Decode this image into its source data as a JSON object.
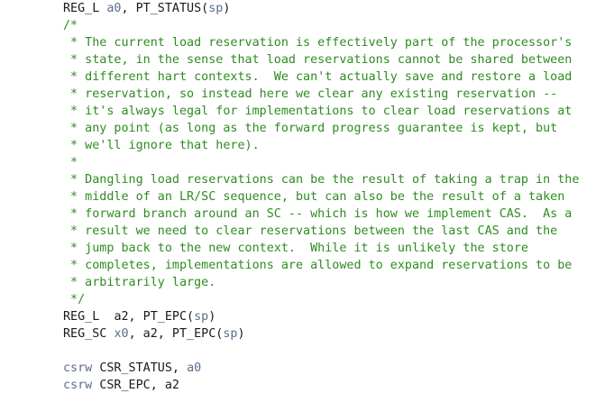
{
  "colors": {
    "comment": "#2e8b20",
    "text": "#1a1a1a",
    "register": "#5a6c8c",
    "background": "#ffffff"
  },
  "lines": [
    {
      "type": "code",
      "parts": [
        {
          "cls": "kw",
          "text": "REG_L "
        },
        {
          "cls": "reg",
          "text": "a0"
        },
        {
          "cls": "kw",
          "text": ", PT_STATUS("
        },
        {
          "cls": "reg",
          "text": "sp"
        },
        {
          "cls": "kw",
          "text": ")"
        }
      ]
    },
    {
      "type": "comment",
      "text": "/*"
    },
    {
      "type": "comment",
      "text": " * The current load reservation is effectively part of the processor's"
    },
    {
      "type": "comment",
      "text": " * state, in the sense that load reservations cannot be shared between"
    },
    {
      "type": "comment",
      "text": " * different hart contexts.  We can't actually save and restore a load"
    },
    {
      "type": "comment",
      "text": " * reservation, so instead here we clear any existing reservation --"
    },
    {
      "type": "comment",
      "text": " * it's always legal for implementations to clear load reservations at"
    },
    {
      "type": "comment",
      "text": " * any point (as long as the forward progress guarantee is kept, but"
    },
    {
      "type": "comment",
      "text": " * we'll ignore that here)."
    },
    {
      "type": "comment",
      "text": " *"
    },
    {
      "type": "comment",
      "text": " * Dangling load reservations can be the result of taking a trap in the"
    },
    {
      "type": "comment",
      "text": " * middle of an LR/SC sequence, but can also be the result of a taken"
    },
    {
      "type": "comment",
      "text": " * forward branch around an SC -- which is how we implement CAS.  As a"
    },
    {
      "type": "comment",
      "text": " * result we need to clear reservations between the last CAS and the"
    },
    {
      "type": "comment",
      "text": " * jump back to the new context.  While it is unlikely the store"
    },
    {
      "type": "comment",
      "text": " * completes, implementations are allowed to expand reservations to be"
    },
    {
      "type": "comment",
      "text": " * arbitrarily large."
    },
    {
      "type": "comment",
      "text": " */"
    },
    {
      "type": "code",
      "parts": [
        {
          "cls": "kw",
          "text": "REG_L  "
        },
        {
          "cls": "kw",
          "text": "a2, PT_EPC("
        },
        {
          "cls": "reg",
          "text": "sp"
        },
        {
          "cls": "kw",
          "text": ")"
        }
      ]
    },
    {
      "type": "code",
      "parts": [
        {
          "cls": "kw",
          "text": "REG_SC "
        },
        {
          "cls": "reg",
          "text": "x0"
        },
        {
          "cls": "kw",
          "text": ", a2, PT_EPC("
        },
        {
          "cls": "reg",
          "text": "sp"
        },
        {
          "cls": "kw",
          "text": ")"
        }
      ]
    },
    {
      "type": "blank",
      "text": ""
    },
    {
      "type": "code",
      "parts": [
        {
          "cls": "instr",
          "text": "csrw "
        },
        {
          "cls": "csr",
          "text": "CSR_STATUS, "
        },
        {
          "cls": "reg",
          "text": "a0"
        }
      ]
    },
    {
      "type": "code",
      "parts": [
        {
          "cls": "instr",
          "text": "csrw "
        },
        {
          "cls": "csr",
          "text": "CSR_EPC, a2"
        }
      ]
    }
  ]
}
